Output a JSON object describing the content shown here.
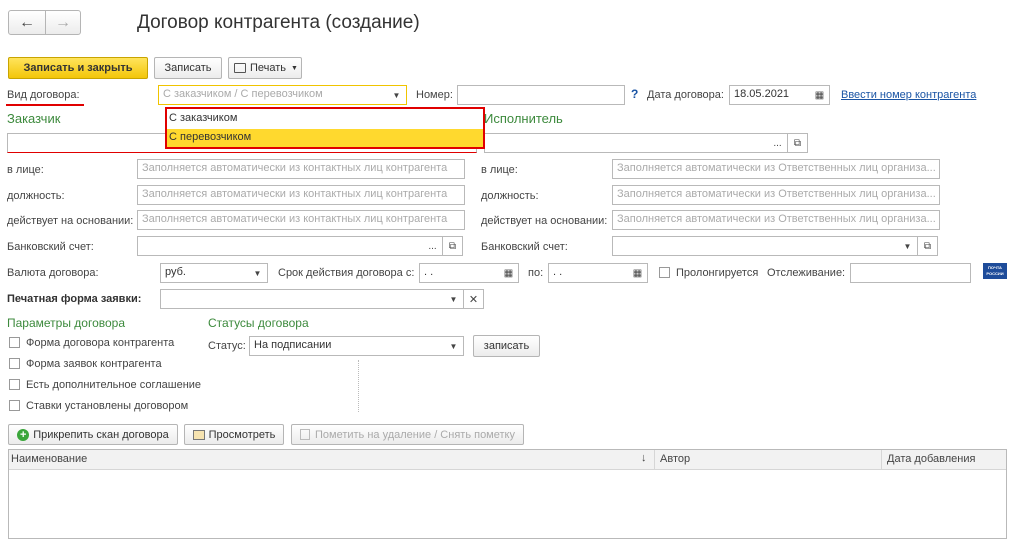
{
  "window": {
    "title": "Договор контрагента (создание)"
  },
  "nav": {
    "back_icon": "arrow-left-icon",
    "forward_icon": "arrow-right-icon"
  },
  "toolbar": {
    "save_close_label": "Записать и закрыть",
    "save_label": "Записать",
    "print_label": "Печать"
  },
  "header": {
    "contract_type_label": "Вид договора:",
    "contract_type_placeholder": "С заказчиком / С перевозчиком",
    "number_label": "Номер:",
    "number_value": "",
    "help_label": "?",
    "date_label": "Дата договора:",
    "date_value": "18.05.2021",
    "enter_number_link": "Ввести номер контрагента"
  },
  "dropdown": {
    "options": [
      "С заказчиком",
      "С перевозчиком"
    ],
    "highlighted": "С перевозчиком"
  },
  "customer": {
    "title": "Заказчик",
    "person_label": "в лице:",
    "person_placeholder": "Заполняется автоматически из контактных лиц контрагента",
    "position_label": "должность:",
    "position_placeholder": "Заполняется автоматически из контактных лиц контрагента",
    "basis_label": "действует на основании:",
    "basis_placeholder": "Заполняется автоматически из контактных лиц контрагента",
    "bank_label": "Банковский счет:"
  },
  "executor": {
    "title": "Исполнитель",
    "person_label": "в лице:",
    "person_placeholder": "Заполняется автоматически из Ответственных лиц организа...",
    "position_label": "должность:",
    "position_placeholder": "Заполняется автоматически из Ответственных лиц организа...",
    "basis_label": "действует на основании:",
    "basis_placeholder": "Заполняется автоматически из Ответственных лиц организа...",
    "bank_label": "Банковский счет:"
  },
  "terms": {
    "currency_label": "Валюта договора:",
    "currency_value": "руб.",
    "period_label": "Срок действия договора с:",
    "period_from": " .  .",
    "period_to_label": "по:",
    "period_to": " .  .",
    "prolong_label": "Пролонгируется",
    "tracking_label": "Отслеживание:",
    "tracking_logo": "ПОЧТА РОССИИ"
  },
  "print_form": {
    "label": "Печатная форма заявки:"
  },
  "params": {
    "title": "Параметры договора",
    "items": [
      "Форма договора контрагента",
      "Форма заявок контрагента",
      "Есть дополнительное соглашение",
      "Ставки установлены договором"
    ]
  },
  "statuses": {
    "title": "Статусы договора",
    "status_label": "Статус:",
    "status_value": "На подписании",
    "save_label": "записать"
  },
  "files": {
    "attach_label": "Прикрепить скан договора",
    "view_label": "Просмотреть",
    "mark_delete_label": "Пометить на удаление / Снять пометку",
    "columns": [
      "Наименование",
      "Автор",
      "Дата добавления"
    ]
  },
  "colors": {
    "accent": "#f3c60a",
    "section": "#3d8a3d",
    "link": "#1a54a4",
    "highlight": "#ffd92e",
    "annotation": "#e00000"
  }
}
